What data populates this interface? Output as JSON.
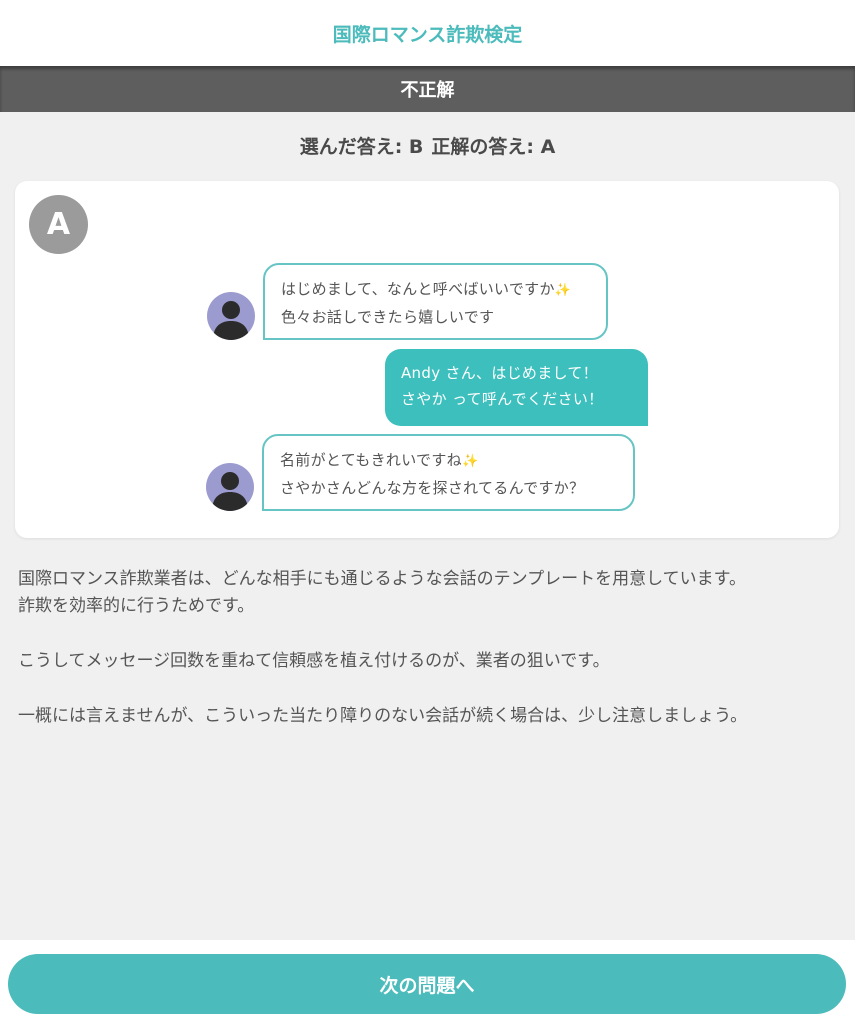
{
  "header": {
    "title": "国際ロマンス詐欺検定"
  },
  "result": {
    "label": "不正解"
  },
  "answer": {
    "selected_label": "選んだ答え: B",
    "correct_label": "正解の答え: A"
  },
  "card": {
    "choice_letter": "A",
    "messages": [
      {
        "sender": "them",
        "lines": [
          "はじめまして、なんと呼べばいいですか",
          "色々お話しできたら嬉しいです"
        ],
        "emoji": "✨"
      },
      {
        "sender": "me",
        "lines": [
          "Andy さん、はじめまして！",
          "さやか って呼んでください！"
        ]
      },
      {
        "sender": "them",
        "lines": [
          "名前がとてもきれいですね",
          "さやかさんどんな方を探されてるんですか？"
        ],
        "emoji": "✨"
      }
    ]
  },
  "explanation": {
    "p1_line1": "国際ロマンス詐欺業者は、どんな相手にも通じるような会話のテンプレートを用意しています。",
    "p1_line2": "詐欺を効率的に行うためです。",
    "p2": "こうしてメッセージ回数を重ねて信頼感を植え付けるのが、業者の狙いです。",
    "p3": "一概には言えませんが、こういった当たり障りのない会話が続く場合は、少し注意しましょう。"
  },
  "footer": {
    "next_label": "次の問題へ"
  },
  "colors": {
    "accent": "#4bbbbb",
    "result_bar": "#5e5e5e",
    "badge": "#9b9b9b"
  }
}
